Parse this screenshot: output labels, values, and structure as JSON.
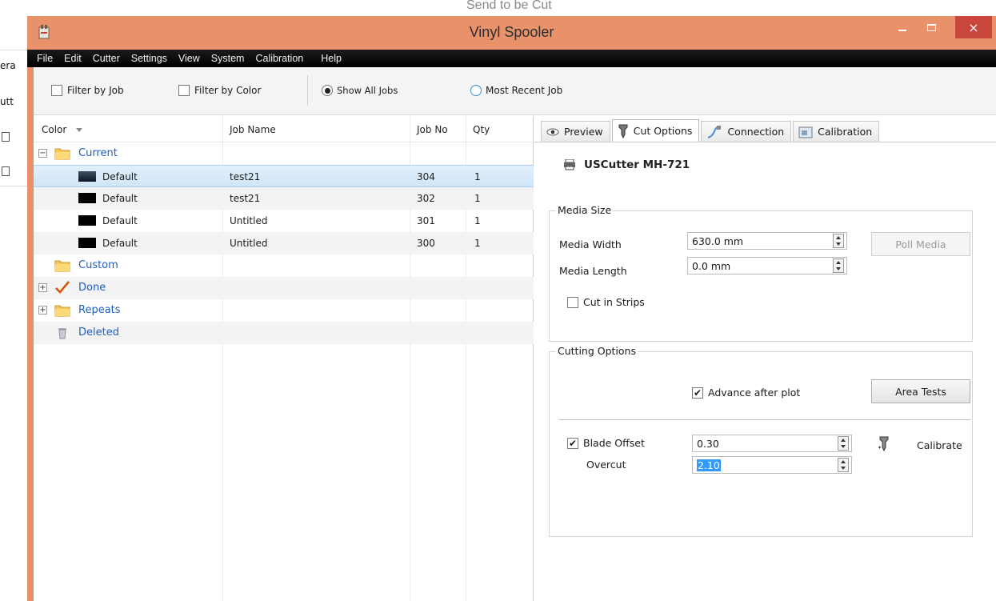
{
  "background_window": {
    "title": "Send to be Cut",
    "fragments": [
      "era",
      "utt"
    ]
  },
  "window": {
    "title": "Vinyl Spooler",
    "minimize": "–",
    "close": "×"
  },
  "menu": [
    "File",
    "Edit",
    "Cutter",
    "Settings",
    "View",
    "System",
    "Calibration",
    "Help"
  ],
  "toolbar": {
    "filter_by_job": "Filter by Job",
    "filter_by_color": "Filter by Color",
    "show_all_jobs": "Show All Jobs",
    "most_recent_job": "Most Recent Job"
  },
  "job_list": {
    "columns": [
      "Color",
      "Job Name",
      "Job No",
      "Qty"
    ],
    "groups": {
      "current": "Current",
      "custom": "Custom",
      "done": "Done",
      "repeats": "Repeats",
      "deleted": "Deleted"
    },
    "jobs": [
      {
        "color": "Default",
        "name": "test21",
        "no": "304",
        "qty": "1"
      },
      {
        "color": "Default",
        "name": "test21",
        "no": "302",
        "qty": "1"
      },
      {
        "color": "Default",
        "name": "Untitled",
        "no": "301",
        "qty": "1"
      },
      {
        "color": "Default",
        "name": "Untitled",
        "no": "300",
        "qty": "1"
      }
    ]
  },
  "tabs": [
    "Preview",
    "Cut Options",
    "Connection",
    "Calibration"
  ],
  "cutter": {
    "name": "USCutter MH-721"
  },
  "media_size": {
    "title": "Media Size",
    "width_label": "Media Width",
    "width_value": "630.0 mm",
    "length_label": "Media Length",
    "length_value": "0.0 mm",
    "poll_media": "Poll Media",
    "cut_in_strips": "Cut in Strips"
  },
  "cutting_options": {
    "title": "Cutting Options",
    "advance_after_plot": "Advance after plot",
    "area_tests": "Area Tests",
    "blade_offset_label": "Blade Offset",
    "blade_offset_value": "0.30",
    "overcut_label": "Overcut",
    "overcut_value": "2.10",
    "calibrate": "Calibrate"
  },
  "colors": {
    "title_bar": "#e8916a",
    "close_button": "#c9463d",
    "menu_bar": "#000000",
    "selection": "#cfe5f7",
    "tree_label": "#1f5fbf"
  }
}
